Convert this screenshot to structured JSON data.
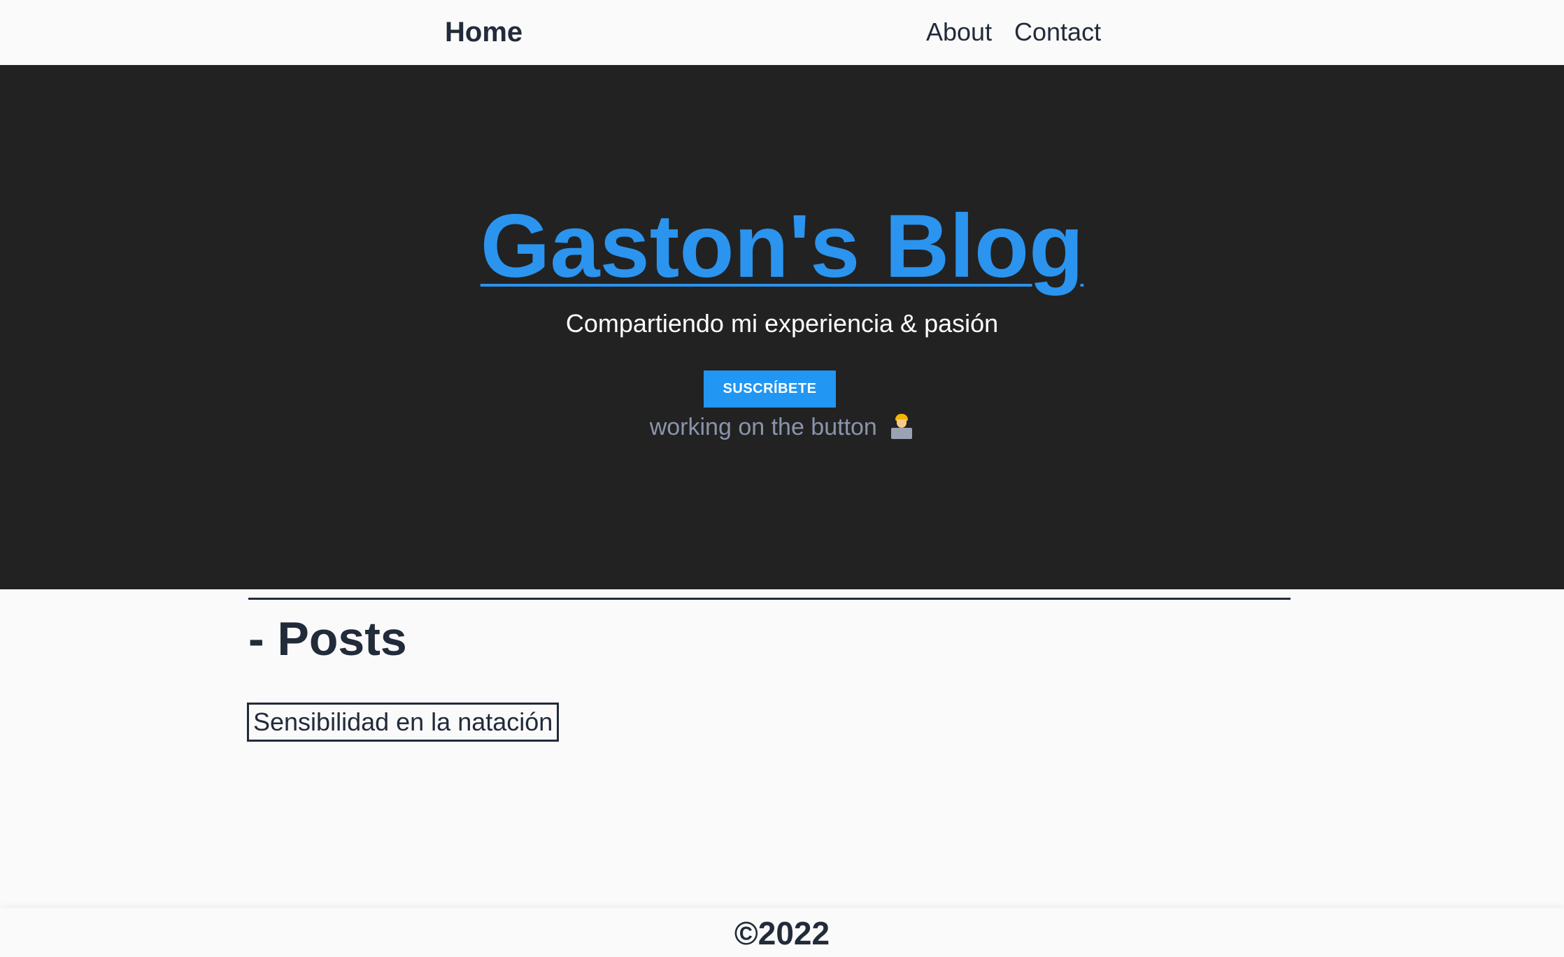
{
  "nav": {
    "home_label": "Home",
    "about_label": "About",
    "contact_label": "Contact"
  },
  "hero": {
    "title": "Gaston's Blog",
    "subtitle": "Compartiendo mi experiencia & pasión",
    "subscribe_label": "SUSCRÍBETE",
    "note": "working on the button",
    "note_icon": "technologist-icon"
  },
  "main": {
    "section_title": "- Posts",
    "posts": [
      {
        "title": "Sensibilidad en la natación"
      }
    ]
  },
  "footer": {
    "text": "©2022"
  },
  "colors": {
    "accent": "#2196f3",
    "hero_bg": "#222222",
    "text_dark": "#222b3a",
    "page_bg": "#fafafa"
  }
}
